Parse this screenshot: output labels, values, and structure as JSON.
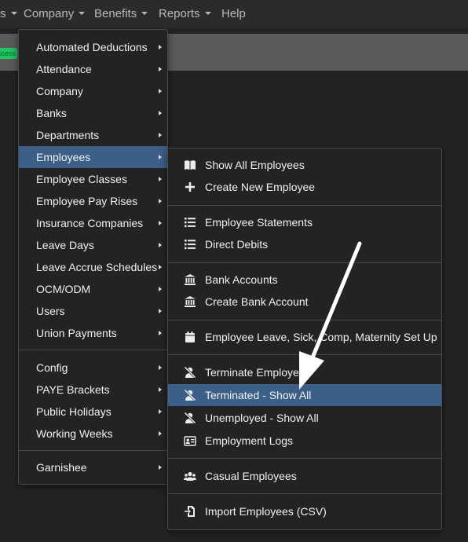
{
  "topnav": {
    "partial_left": "s",
    "items": [
      {
        "label": "Company"
      },
      {
        "label": "Benefits"
      },
      {
        "label": "Reports"
      },
      {
        "label": "Help"
      }
    ]
  },
  "status_badge": "ccess",
  "main_menu": {
    "items": [
      {
        "label": "Automated Deductions"
      },
      {
        "label": "Attendance"
      },
      {
        "label": "Company"
      },
      {
        "label": "Banks"
      },
      {
        "label": "Departments"
      },
      {
        "label": "Employees",
        "active": true
      },
      {
        "label": "Employee Classes"
      },
      {
        "label": "Employee Pay Rises"
      },
      {
        "label": "Insurance Companies"
      },
      {
        "label": "Leave Days"
      },
      {
        "label": "Leave Accrue Schedules"
      },
      {
        "label": "OCM/ODM"
      },
      {
        "label": "Users"
      },
      {
        "label": "Union Payments"
      },
      {
        "label": "Config"
      },
      {
        "label": "PAYE Brackets"
      },
      {
        "label": "Public Holidays"
      },
      {
        "label": "Working Weeks"
      },
      {
        "label": "Garnishee"
      }
    ]
  },
  "employees_submenu": {
    "items": [
      {
        "label": "Show All Employees",
        "icon": "book-icon"
      },
      {
        "label": "Create New Employee",
        "icon": "plus-icon"
      },
      {
        "label": "Employee Statements",
        "icon": "list-icon"
      },
      {
        "label": "Direct Debits",
        "icon": "list-icon"
      },
      {
        "label": "Bank Accounts",
        "icon": "bank-icon"
      },
      {
        "label": "Create Bank Account",
        "icon": "bank-icon"
      },
      {
        "label": "Employee Leave, Sick, Comp, Maternity Set Up",
        "icon": "calendar-icon"
      },
      {
        "label": "Terminate Employee",
        "icon": "user-slash-icon"
      },
      {
        "label": "Terminated - Show All",
        "icon": "user-slash-icon",
        "active": true
      },
      {
        "label": "Unemployed - Show All",
        "icon": "user-slash-icon"
      },
      {
        "label": "Employment Logs",
        "icon": "id-card-icon"
      },
      {
        "label": "Casual Employees",
        "icon": "users-icon"
      },
      {
        "label": "Import Employees (CSV)",
        "icon": "file-import-icon"
      }
    ]
  },
  "colors": {
    "active_item": "#3c5f88",
    "success_badge": "#22c55e",
    "background": "#232323"
  }
}
